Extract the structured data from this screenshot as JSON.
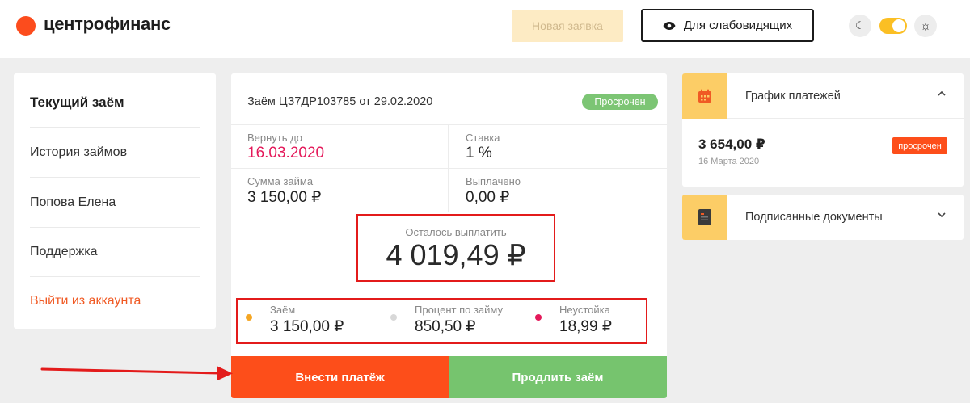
{
  "header": {
    "logo_text": "центрофинанс",
    "new_application_label": "Новая заявка",
    "accessibility_label": "Для слабовидящих"
  },
  "sidebar": {
    "items": [
      {
        "label": "Текущий заём"
      },
      {
        "label": "История займов"
      },
      {
        "label": "Попова Елена"
      },
      {
        "label": "Поддержка"
      },
      {
        "label": "Выйти из аккаунта"
      }
    ]
  },
  "loan": {
    "title": "Заём ЦЗ7ДР103785 от 29.02.2020",
    "status": "Просрочен",
    "repay_by_label": "Вернуть до",
    "repay_by_value": "16.03.2020",
    "rate_label": "Ставка",
    "rate_value": "1 %",
    "amount_label": "Сумма займа",
    "amount_value": "3 150,00 ₽",
    "paid_label": "Выплачено",
    "paid_value": "0,00 ₽",
    "remaining_label": "Осталось выплатить",
    "remaining_value": "4 019,49 ₽",
    "breakdown": [
      {
        "label": "Заём",
        "value": "3 150,00 ₽",
        "color": "#f5a623"
      },
      {
        "label": "Процент по займу",
        "value": "850,50 ₽",
        "color": "#d8d8d8"
      },
      {
        "label": "Неустойка",
        "value": "18,99 ₽",
        "color": "#e4195a"
      }
    ],
    "pay_button": "Внести платёж",
    "extend_button": "Продлить заём"
  },
  "schedule": {
    "title": "График платежей",
    "amount": "3 654,00 ₽",
    "date": "16 Марта 2020",
    "status": "просрочен"
  },
  "documents": {
    "title": "Подписанные документы"
  },
  "colors": {
    "brand": "#fc4c1d",
    "accent_yellow": "#fccd66",
    "success": "#76c46e",
    "danger": "#e4195a",
    "annotation": "#e31b1b"
  }
}
